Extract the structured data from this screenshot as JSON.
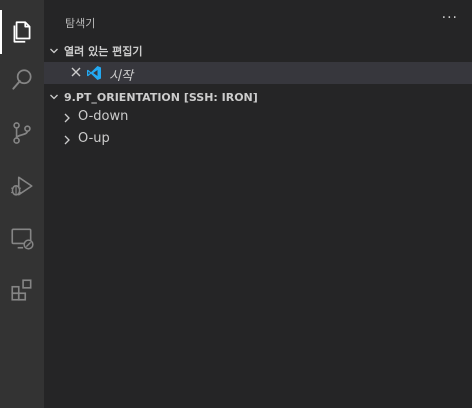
{
  "activity_bar": {
    "items": [
      {
        "icon": "files-icon",
        "active": true
      },
      {
        "icon": "search-icon",
        "active": false
      },
      {
        "icon": "source-control-icon",
        "active": false
      },
      {
        "icon": "run-debug-icon",
        "active": false
      },
      {
        "icon": "remote-explorer-icon",
        "active": false
      },
      {
        "icon": "extensions-icon",
        "active": false
      }
    ]
  },
  "sidebar": {
    "title": "탐색기",
    "more_actions": "···",
    "open_editors": {
      "label": "열려 있는 편집기",
      "items": [
        {
          "name": "시작",
          "icon": "vscode-icon"
        }
      ]
    },
    "folder": {
      "label": "9.PT_ORIENTATION [SSH: IRON]",
      "items": [
        {
          "name": "O-down",
          "expanded": false
        },
        {
          "name": "O-up",
          "expanded": false
        }
      ]
    }
  },
  "colors": {
    "activity_bar": "#333333",
    "sidebar": "#252526",
    "selected_row": "#37373d",
    "vscode_blue": "#23a9f2"
  }
}
